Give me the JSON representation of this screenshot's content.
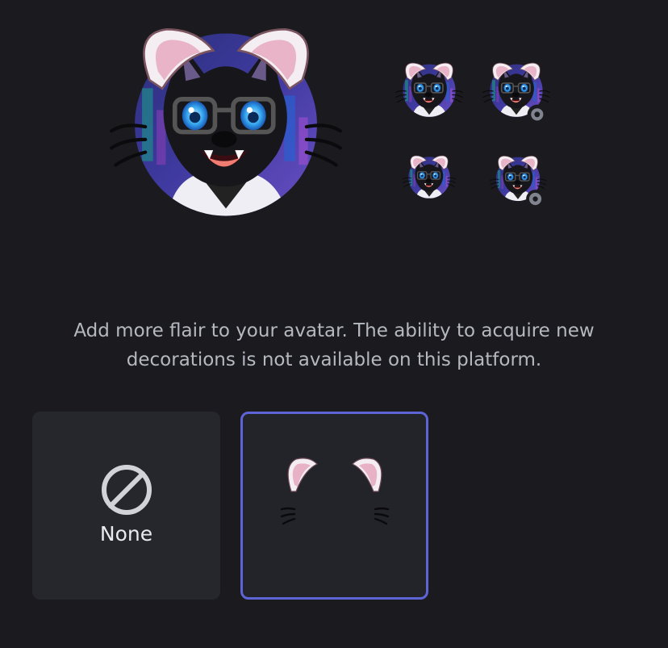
{
  "preview": {
    "large_avatar_icon": "wolf-avatar-with-cat-ears",
    "small_avatar_icon": "wolf-avatar-small",
    "status_icon": "offline-status-dot"
  },
  "description": "Add more flair to your avatar. The ability to acquire new decorations is not available on this platform.",
  "decorations": [
    {
      "label": "None",
      "icon": "none-icon",
      "selected": false
    },
    {
      "label": "",
      "icon": "cat-ears-whiskers-icon",
      "selected": true
    }
  ],
  "colors": {
    "background": "#1b1b1f",
    "tile": "#26272d",
    "selected_border": "#5c64d6",
    "text": "#b5b8bf",
    "ear_pink": "#f0bcd0"
  }
}
